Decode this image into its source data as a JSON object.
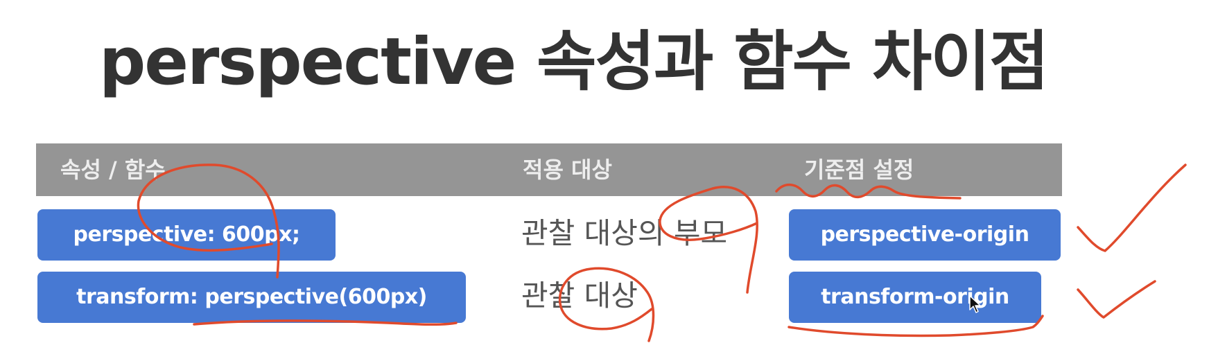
{
  "slide": {
    "title": "perspective 속성과 함수 차이점"
  },
  "table": {
    "headers": [
      "속성 / 함수",
      "적용 대상",
      "기준점 설정"
    ],
    "rows": [
      {
        "property": "perspective: 600px;",
        "target": "관찰 대상의 부모",
        "origin": "perspective-origin"
      },
      {
        "property": "transform: perspective(600px)",
        "target": "관찰 대상",
        "origin": "transform-origin"
      }
    ]
  },
  "colors": {
    "title_text": "#333333",
    "header_background": "#959595",
    "header_text": "#eeeeee",
    "pill_background": "#4779d3",
    "annotation_ink": "#e04a2c"
  },
  "annotations": {
    "checkmark_icon_count": 2
  }
}
